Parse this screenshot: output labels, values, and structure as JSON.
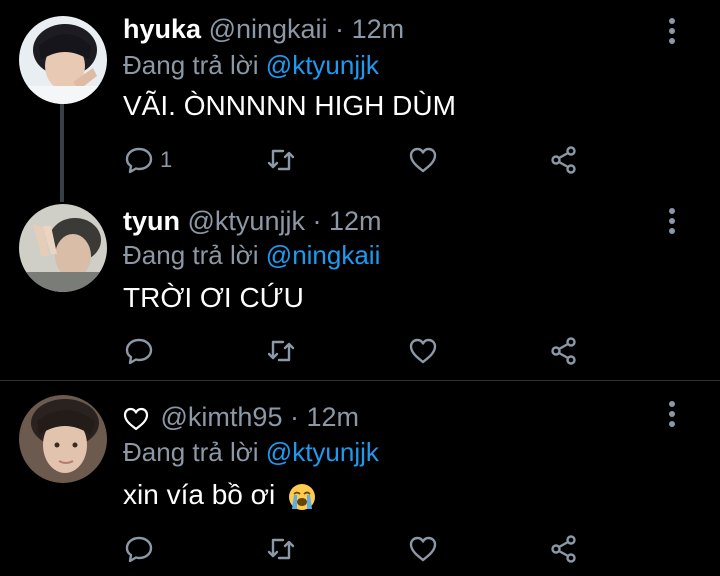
{
  "tweets": [
    {
      "name": "hyuka",
      "handle": "@ningkaii",
      "separator": "·",
      "time": "12m",
      "reply_prefix": "Đang trả lời",
      "reply_to": "@ktyunjjk",
      "text": "VÃI. ÒNNNNN HIGH DÙM",
      "reply_count": "1"
    },
    {
      "name": "tyun",
      "handle": "@ktyunjjk",
      "separator": "·",
      "time": "12m",
      "reply_prefix": "Đang trả lời",
      "reply_to": "@ningkaii",
      "text": "TRỜI ƠI CỨU",
      "reply_count": ""
    },
    {
      "name": "",
      "name_icon": "heart-outline-icon",
      "handle": "@kimth95",
      "separator": "·",
      "time": "12m",
      "reply_prefix": "Đang trả lời",
      "reply_to": "@ktyunjjk",
      "text": "xin vía bồ ơi",
      "text_emoji": "loudly-crying-face-emoji",
      "reply_count": ""
    }
  ],
  "colors": {
    "background": "#000000",
    "muted": "#8b98a5",
    "link": "#1d9bf0",
    "divider": "#2f3336"
  }
}
